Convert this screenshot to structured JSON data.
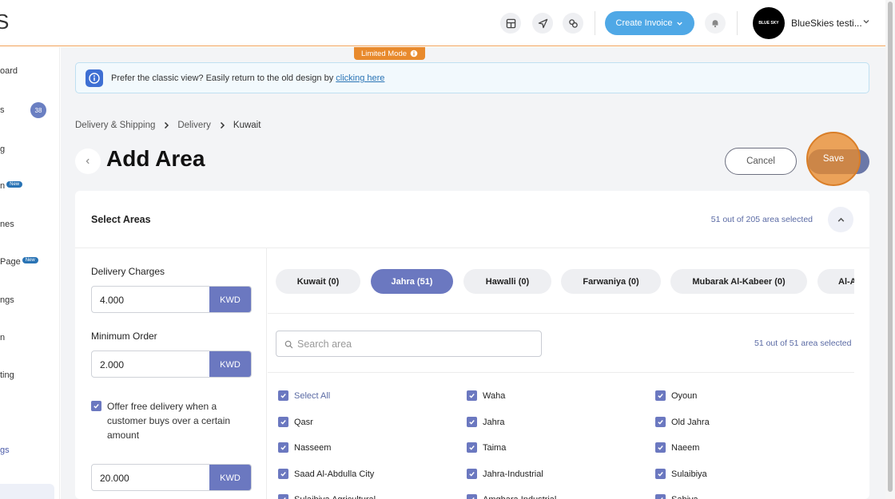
{
  "header": {
    "logo_text": "S",
    "create_invoice_label": "Create Invoice",
    "avatar_text": "BLUE SKY",
    "account_name": "BlueSkies testi...",
    "limited_mode_label": "Limited Mode"
  },
  "sidebar": {
    "items": [
      {
        "label": "oard"
      },
      {
        "label": "s",
        "count": "38"
      },
      {
        "label": "g"
      },
      {
        "label": "n",
        "badge": "New"
      },
      {
        "label": "nes"
      },
      {
        "label": "Page",
        "badge": "New"
      },
      {
        "label": "ngs"
      },
      {
        "label": "n"
      },
      {
        "label": "ting"
      },
      {
        "label": "gs"
      }
    ]
  },
  "notice": {
    "text": "Prefer the classic view? Easily return to the old design by ",
    "link_text": "clicking here"
  },
  "breadcrumb": [
    "Delivery & Shipping",
    "Delivery",
    "Kuwait"
  ],
  "page": {
    "title": "Add Area",
    "cancel_label": "Cancel",
    "save_label": "Save"
  },
  "card": {
    "title": "Select Areas",
    "selected_summary": "51 out of 205 area selected"
  },
  "form": {
    "delivery_charges_label": "Delivery Charges",
    "delivery_charges_value": "4.000",
    "minimum_order_label": "Minimum Order",
    "minimum_order_value": "2.000",
    "currency": "KWD",
    "offer_checked": true,
    "offer_label": "Offer free delivery when a customer buys over a certain amount",
    "free_delivery_value": "20.000"
  },
  "governorate_tabs": [
    {
      "label": "Kuwait (0)",
      "active": false
    },
    {
      "label": "Jahra (51)",
      "active": true
    },
    {
      "label": "Hawalli (0)",
      "active": false
    },
    {
      "label": "Farwaniya (0)",
      "active": false
    },
    {
      "label": "Mubarak Al-Kabeer (0)",
      "active": false
    },
    {
      "label": "Al-A",
      "active": false
    }
  ],
  "search": {
    "placeholder": "Search area"
  },
  "areas_selected_summary": "51 out of 51 area selected",
  "areas": {
    "select_all_label": "Select All",
    "col1": [
      "Select All",
      "Qasr",
      "Nasseem",
      "Saad Al-Abdulla City",
      "Sulaibiya Agricultural"
    ],
    "col2": [
      "Waha",
      "Jahra",
      "Taima",
      "Jahra-Industrial",
      "Amghara Industrial"
    ],
    "col3": [
      "Oyoun",
      "Old Jahra",
      "Naeem",
      "Sulaibiya",
      "Sabiya"
    ]
  },
  "colors": {
    "accent": "#6b78c0",
    "create_button": "#4fa8e6",
    "limited_mode": "#e88a2d",
    "info_icon": "#3e6fd3"
  }
}
